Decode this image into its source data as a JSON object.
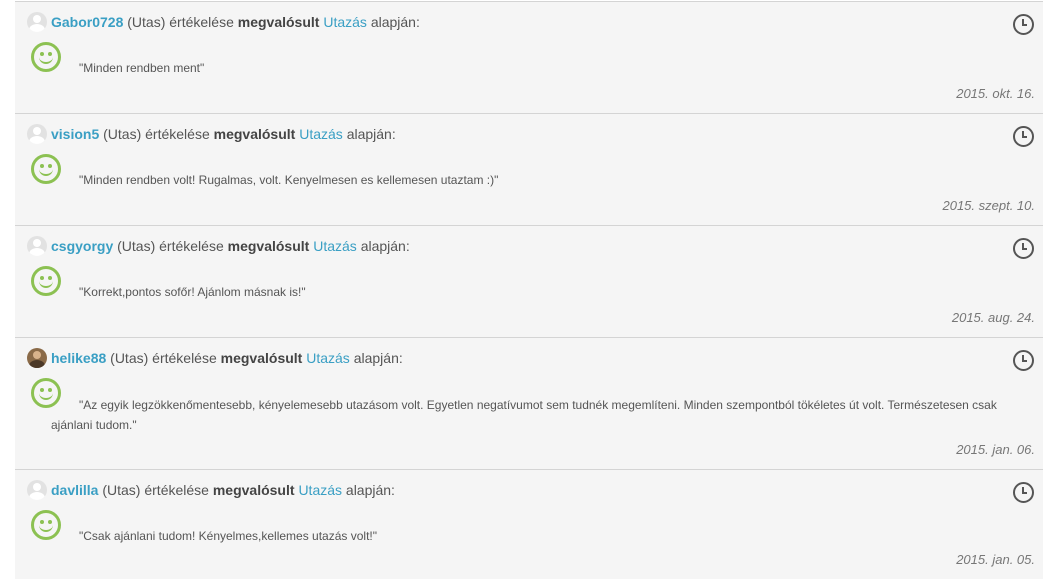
{
  "labels": {
    "role": "(Utas) értékelése",
    "status": "megvalósult",
    "trip": "Utazás",
    "suffix": "alapján:"
  },
  "colors": {
    "link": "#3a9fc4",
    "positive": "#8cc152",
    "panel": "#f5f5f5"
  },
  "reviews": [
    {
      "user": "Gabor0728",
      "comment": "\"Minden rendben ment\"",
      "date": "2015. okt. 16.",
      "avatar": "default-avatar-icon"
    },
    {
      "user": "vision5",
      "comment": "\"Minden rendben volt! Rugalmas, volt. Kenyelmesen es kellemesen utaztam :)\"",
      "date": "2015. szept. 10.",
      "avatar": "default-avatar-icon"
    },
    {
      "user": "csgyorgy",
      "comment": "\"Korrekt,pontos sofőr! Ajánlom másnak is!\"",
      "date": "2015. aug. 24.",
      "avatar": "default-avatar-icon"
    },
    {
      "user": "helike88",
      "comment": "\"Az egyik legzökkenőmentesebb, kényelemesebb utazásom volt. Egyetlen negatívumot sem tudnék megemlíteni. Minden szempontból tökéletes út volt. Természetesen csak ajánlani tudom.\"",
      "date": "2015. jan. 06.",
      "avatar": "photo-avatar-icon"
    },
    {
      "user": "davlilla",
      "comment": "\"Csak ajánlani tudom! Kényelmes,kellemes utazás volt!\"",
      "date": "2015. jan. 05.",
      "avatar": "default-avatar-icon"
    }
  ]
}
